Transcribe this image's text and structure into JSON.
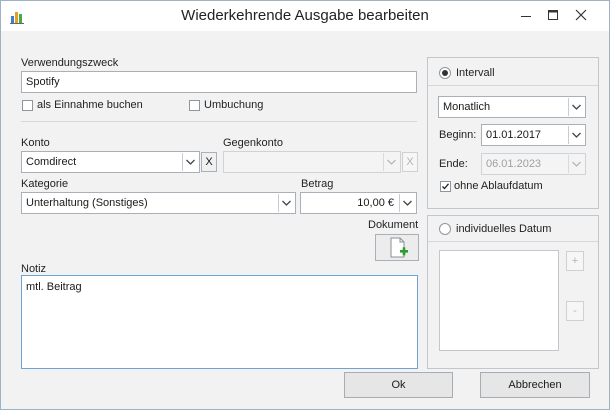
{
  "window": {
    "title": "Wiederkehrende Ausgabe bearbeiten"
  },
  "form": {
    "verwendungszweck_label": "Verwendungszweck",
    "verwendungszweck_value": "Spotify",
    "als_einnahme_label": "als Einnahme buchen",
    "als_einnahme_checked": false,
    "umbuchung_label": "Umbuchung",
    "umbuchung_checked": false,
    "konto_label": "Konto",
    "konto_value": "Comdirect",
    "konto_clear": "X",
    "gegenkonto_label": "Gegenkonto",
    "gegenkonto_value": "",
    "gegenkonto_clear": "X",
    "kategorie_label": "Kategorie",
    "kategorie_value": "Unterhaltung (Sonstiges)",
    "betrag_label": "Betrag",
    "betrag_value": "10,00 €",
    "dokument_label": "Dokument",
    "notiz_label": "Notiz",
    "notiz_value": "mtl. Beitrag"
  },
  "schedule": {
    "intervall_label": "Intervall",
    "intervall_selected": true,
    "interval_value": "Monatlich",
    "beginn_label": "Beginn:",
    "beginn_value": "01.01.2017",
    "ende_label": "Ende:",
    "ende_value": "06.01.2023",
    "ohne_ablauf_label": "ohne Ablaufdatum",
    "ohne_ablauf_checked": true,
    "individuell_label": "individuelles Datum",
    "individuell_selected": false,
    "add_label": "+",
    "remove_label": "-"
  },
  "buttons": {
    "ok": "Ok",
    "cancel": "Abbrechen"
  },
  "colors": {
    "window_bg": "#f2f2f2",
    "titlebar_bg": "#ffffff",
    "border": "#9cb2c9",
    "accent_green": "#2e9b2e"
  },
  "icons": {
    "app": "bar-chart-icon",
    "document_add": "document-add-icon"
  }
}
